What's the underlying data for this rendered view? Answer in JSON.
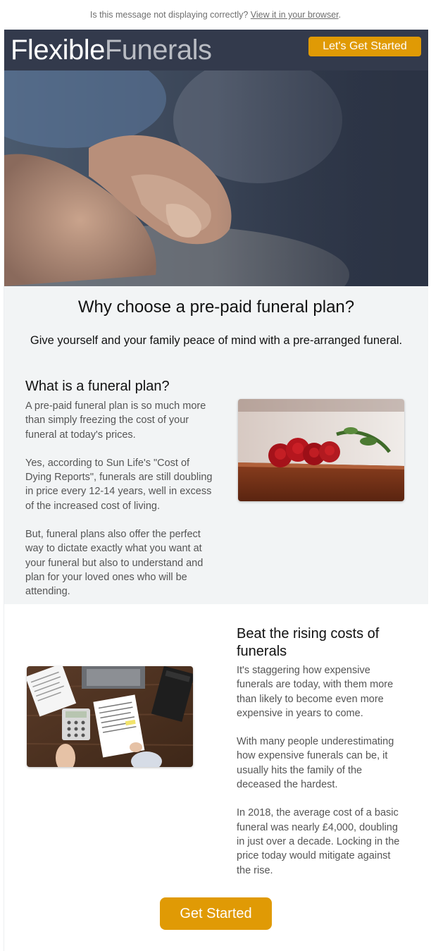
{
  "preheader": {
    "text": "Is this message not displaying correctly?",
    "link": "View it in your browser",
    "end": "."
  },
  "header": {
    "logo_part1": "Flexible",
    "logo_part2": "Funerals",
    "cta_label": "Let's Get Started"
  },
  "intro": {
    "title": "Why choose a pre-paid funeral plan?",
    "lead": "Give yourself and your family peace of mind with a pre-arranged funeral."
  },
  "section1": {
    "heading": "What is a funeral plan?",
    "paragraphs": [
      "A pre-paid funeral plan is so much more than simply freezing the cost of your funeral at today's prices.",
      "Yes, according to Sun Life's \"Cost of Dying Reports\", funerals are still doubling in price every 12-14 years, well in excess of the increased cost of living.",
      "But, funeral plans also offer the perfect way to dictate exactly what you want at your funeral but also to understand and plan for your loved ones who will be attending."
    ]
  },
  "section2": {
    "heading": "Beat the rising costs of funerals",
    "paragraphs": [
      "It's staggering how expensive funerals are today, with them more than likely to become even more expensive in years to come.",
      "With many people underestimating how expensive funerals can be, it usually hits the family of the deceased the hardest.",
      "In 2018, the average cost of a basic funeral was nearly £4,000, doubling in just over a decade. Locking in the price today would mitigate against the rise."
    ],
    "cta_label": "Get Started"
  },
  "colors": {
    "header_bg": "#333a4c",
    "accent": "#e09a05",
    "section_bg": "#f2f4f5",
    "body_text": "#555555"
  }
}
